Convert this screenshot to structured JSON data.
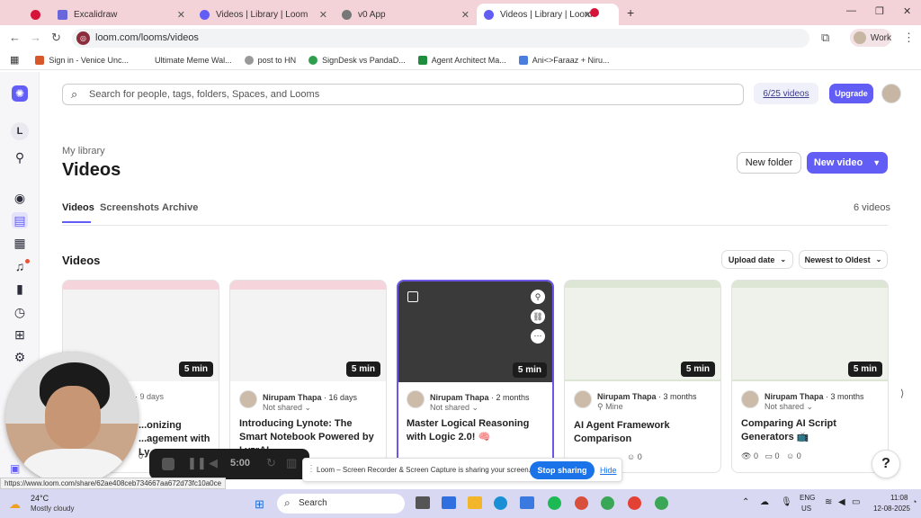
{
  "browser": {
    "tabs": [
      {
        "label": "",
        "icon": "loom-red-icon",
        "color": "#d6143a",
        "active": false
      },
      {
        "label": "Excalidraw",
        "icon": "excalidraw-icon",
        "color": "#6965db",
        "active": false
      },
      {
        "label": "Videos | Library | Loom",
        "icon": "loom-icon",
        "color": "#625df5",
        "active": false
      },
      {
        "label": "v0 App",
        "icon": "globe-icon",
        "color": "#666666",
        "active": false
      },
      {
        "label": "Videos | Library | Loom",
        "icon": "loom-icon",
        "color": "#625df5",
        "active": true
      },
      {
        "label": "",
        "icon": "record-icon",
        "color": "#d6143a",
        "active": false
      }
    ],
    "url": "loom.com/looms/videos",
    "profile": "Work",
    "bookmarks": [
      "Sign in - Venice Unc...",
      "Ultimate Meme Wal...",
      "post to HN",
      "SignDesk vs PandaD...",
      "Agent Architect Ma...",
      "Ani<>Faraaz + Niru..."
    ]
  },
  "loom": {
    "search_placeholder": "Search for people, tags, folders, Spaces, and Looms",
    "video_quota": "6/25 videos",
    "upgrade_label": "Upgrade",
    "workspace_initial": "L",
    "breadcrumb": "My library",
    "page_title": "Videos",
    "new_folder_label": "New folder",
    "new_video_label": "New video",
    "tabs": [
      "Videos",
      "Screenshots",
      "Archive"
    ],
    "video_count": "6 videos",
    "section_title": "Videos",
    "sort_field": "Upload date",
    "sort_order": "Newest to Oldest",
    "accent": "#625df5",
    "videos": [
      {
        "owner": "",
        "age": "· 9 days",
        "share": "",
        "title": "...onizing ...agement with Ly...",
        "duration": "5 min",
        "views": "",
        "comments": "",
        "reactions": "0"
      },
      {
        "owner": "Nirupam Thapa",
        "age": "· 16 days",
        "share": "Not shared",
        "title": "Introducing Lynote: The Smart Notebook Powered by LyzrAI",
        "duration": "5 min",
        "views": "",
        "comments": "",
        "reactions": ""
      },
      {
        "owner": "Nirupam Thapa",
        "age": "· 2 months",
        "share": "Not shared",
        "title": "Master Logical Reasoning with Logic 2.0! 🧠",
        "duration": "5 min",
        "views": "0",
        "comments": "0",
        "reactions": "0"
      },
      {
        "owner": "Nirupam Thapa",
        "age": "· 3 months",
        "share": "Mine",
        "title": "AI Agent Framework Comparison",
        "duration": "5 min",
        "views": "0",
        "comments": "0",
        "reactions": "0"
      },
      {
        "owner": "Nirupam Thapa",
        "age": "· 3 months",
        "share": "Not shared",
        "title": "Comparing AI Script Generators 📺",
        "duration": "5 min",
        "views": "0",
        "comments": "0",
        "reactions": "0"
      }
    ],
    "help_label": "?"
  },
  "recorder": {
    "timer": "5:00"
  },
  "share_bar": {
    "message": "Loom – Screen Recorder & Screen Capture is sharing your screen.",
    "stop_label": "Stop sharing",
    "hide_label": "Hide"
  },
  "status_url": "https://www.loom.com/share/62ae408ceb734667aa672d73fc10a0ce",
  "taskbar": {
    "weather_temp": "24°C",
    "weather_desc": "Mostly cloudy",
    "search_label": "Search",
    "lang_top": "ENG",
    "lang_bottom": "US",
    "time": "11:08",
    "date": "12-08-2025"
  }
}
